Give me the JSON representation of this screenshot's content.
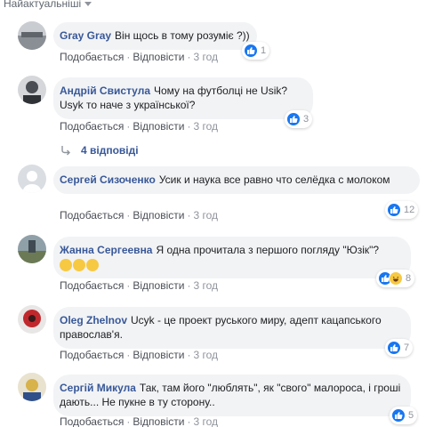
{
  "sort_label": "Найактуальніші",
  "comments": [
    {
      "author": "Gray Gray",
      "text": "Він щось в тому розуміє ?))",
      "like_label": "Подобається",
      "reply_label": "Відповісти",
      "time": "3 год",
      "reactions": "1",
      "avatar_color": "#b8bcc4"
    },
    {
      "author": "Андрій Свистула",
      "text": "Чому на футболці не Usik? Usyk то наче з української?",
      "like_label": "Подобається",
      "reply_label": "Відповісти",
      "time": "3 год",
      "reactions": "3",
      "avatar_color": "#5a5f66"
    },
    {
      "author": "Сергей Сизоченко",
      "text": "Усик и наука все равно что селёдка с молоком",
      "like_label": "Подобається",
      "reply_label": "Відповісти",
      "time": "3 год",
      "reactions": "12",
      "avatar_color": "#dadde1"
    },
    {
      "author": "Жанна Сергеевна",
      "text": "Я одна прочитала з першого погляду \"Юзік\"?",
      "like_label": "Подобається",
      "reply_label": "Відповісти",
      "time": "3 год",
      "reactions": "8",
      "avatar_color": "#9aa3a9"
    },
    {
      "author": "Oleg Zhelnov",
      "text": "Ucyk - це проект руського миру, адепт кацапського православ'я.",
      "like_label": "Подобається",
      "reply_label": "Відповісти",
      "time": "3 год",
      "reactions": "7",
      "avatar_color": "#c0282d"
    },
    {
      "author": "Сергій Микула",
      "text": "Так, там його \"люблять\", як \"свого\" малороса, і гроші дають... Не пукне в ту сторону..",
      "like_label": "Подобається",
      "reply_label": "Відповісти",
      "time": "3 год",
      "reactions": "5",
      "avatar_color": "#d8b24a"
    }
  ],
  "replies_label": "4 відповіді",
  "separator": "·",
  "colors": {
    "link": "#385898",
    "bubble": "#f2f3f5",
    "like": "#1877f2",
    "haha": "#f7c942"
  },
  "icons": [
    "like-icon",
    "haha-icon",
    "reply-arrow-icon",
    "chevron-down-icon",
    "default-avatar-icon"
  ]
}
